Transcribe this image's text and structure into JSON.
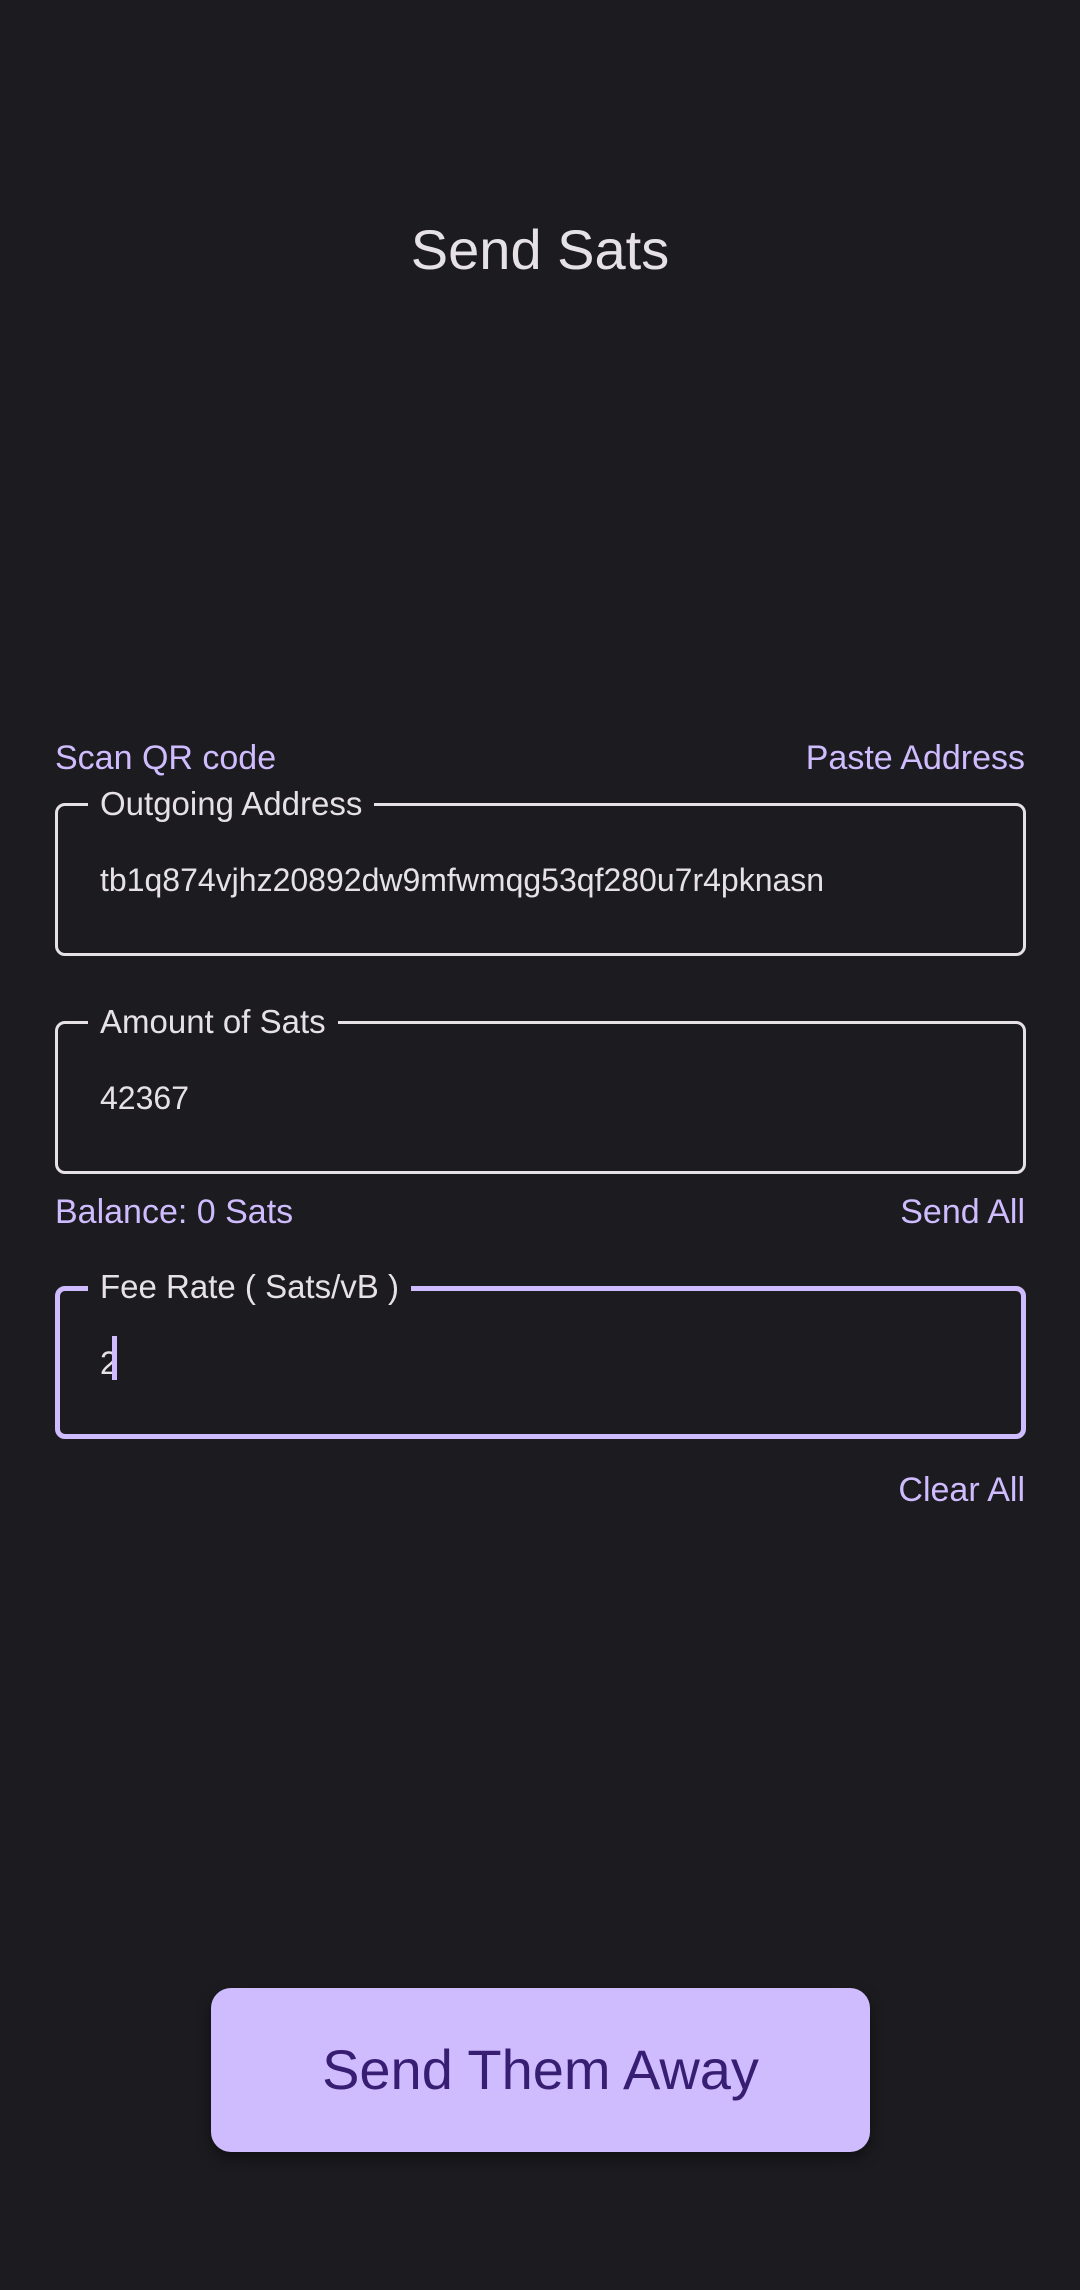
{
  "header": {
    "title": "Send Sats"
  },
  "address_section": {
    "scan_qr_label": "Scan QR code",
    "paste_address_label": "Paste Address",
    "field_label": "Outgoing Address",
    "value": "tb1q874vjhz20892dw9mfwmqg53qf280u7r4pknasn"
  },
  "amount_section": {
    "field_label": "Amount of Sats",
    "value": "42367",
    "balance_text": "Balance: 0 Sats",
    "send_all_label": "Send All"
  },
  "fee_section": {
    "field_label": "Fee Rate ( Sats/vB )",
    "value": "2",
    "clear_all_label": "Clear All"
  },
  "actions": {
    "send_button_label": "Send Them Away"
  },
  "colors": {
    "background": "#1c1b1f",
    "accent": "#cfbcff",
    "on_accent": "#381e72",
    "text": "#e6e1e5"
  }
}
